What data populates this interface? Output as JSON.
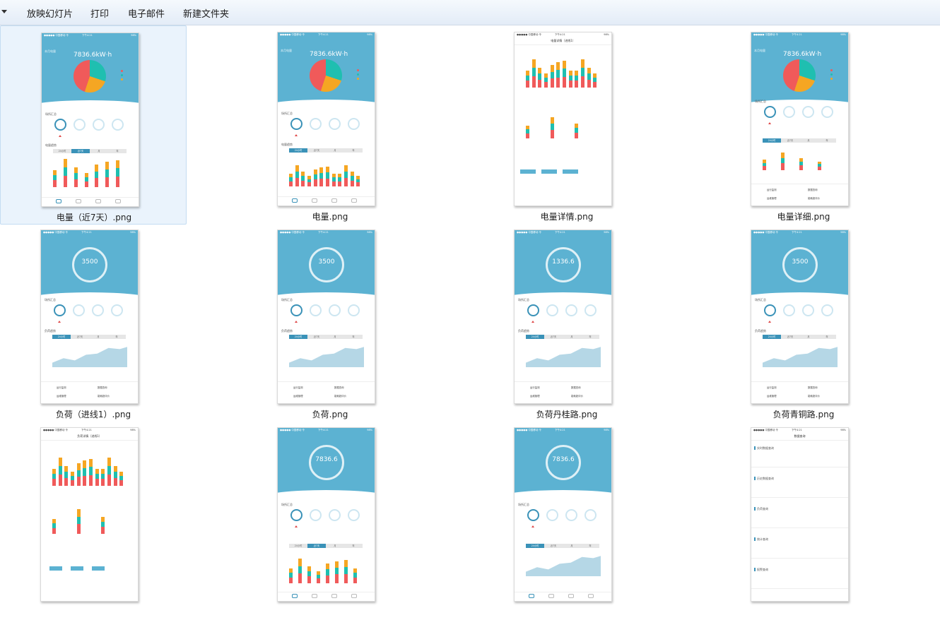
{
  "toolbar": {
    "slideshow_label": "放映幻灯片",
    "print_label": "打印",
    "email_label": "电子邮件",
    "new_folder_label": "新建文件夹"
  },
  "files": [
    {
      "name": "电量（近7天）.png",
      "selected": true
    },
    {
      "name": "电量.png"
    },
    {
      "name": "电量详情.png"
    },
    {
      "name": "电量详细.png"
    },
    {
      "name": "负荷（进线1）.png"
    },
    {
      "name": "负荷.png"
    },
    {
      "name": "负荷丹桂路.png"
    },
    {
      "name": "负荷青铜路.png"
    },
    {
      "name": "",
      "caption_hidden": true
    },
    {
      "name": "",
      "caption_hidden": true
    },
    {
      "name": "",
      "caption_hidden": true
    },
    {
      "name": "",
      "caption_hidden": true
    }
  ],
  "thumb_text": {
    "status_carrier": "●●●●● 中国移动 令",
    "status_time": "下午4:21",
    "status_battery": "98%",
    "energy_value": "7836.6kW·h",
    "energy_label": "本月电量",
    "summary_title": "场所汇总",
    "trend_title": "电量趋势",
    "load_trend_title": "负荷趋势",
    "load_value_a": "3500",
    "load_value_b": "1336.6",
    "load_value_c": "7836.6",
    "detail_title": "电量详情（进线1）",
    "load_detail_title": "负荷详情（进线1）",
    "query_title": "数据查询",
    "seg_options": [
      "24小时",
      "近7天",
      "月",
      "年"
    ],
    "menu_items": [
      "运行监测",
      "数据查询",
      "运维管理",
      "能耗趋评价"
    ],
    "query_items": [
      "实时数据查询",
      "历史数据查询",
      "负荷查询",
      "统计查询",
      "报警查询"
    ]
  },
  "colors": {
    "header_blue": "#5cb2d2",
    "accent_blue": "#3a92b8",
    "red": "#f05a5a",
    "teal": "#1fbfb0",
    "orange": "#f5a623",
    "light_blue_area": "#b5d7e6"
  }
}
